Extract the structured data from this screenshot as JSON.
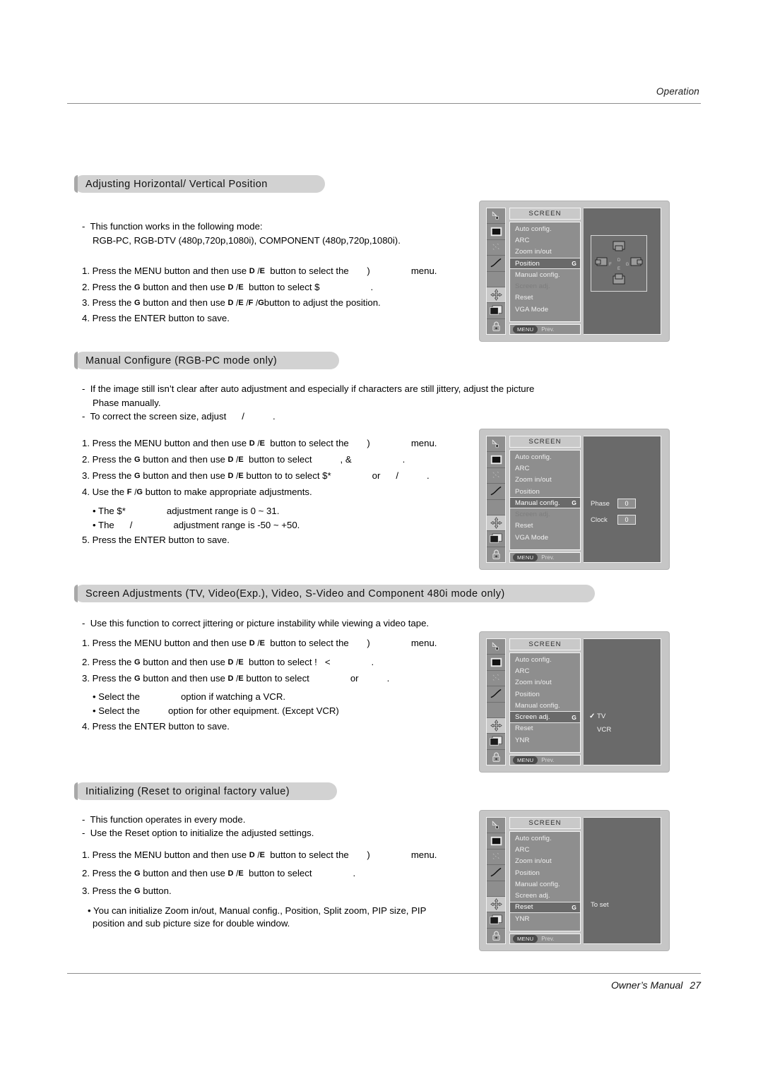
{
  "header": {
    "label": "Operation"
  },
  "footer": {
    "label": "Owner’s Manual",
    "page": "27"
  },
  "sections": [
    {
      "heading": "Adjusting Horizontal/ Vertical Position",
      "lines": {
        "d1a": "-  This function works in the following mode:",
        "d1b": "RGB-PC, RGB-DTV (480p,720p,1080i), COMPONENT (480p,720p,1080i).",
        "s1a": "1. Press the MENU button and then use",
        "s1b": "button to select the",
        "s1c": ")",
        "s1d": "menu.",
        "s2a": "2. Press the",
        "s2b": "button and then use",
        "s2c": "button to select $",
        "s2d": ".",
        "s3a": "3. Press the",
        "s3b": "button and then use",
        "s3c": "button to adjust the position.",
        "s4": "4. Press the ENTER button to save."
      }
    },
    {
      "heading": "Manual Configure (RGB-PC mode only)",
      "lines": {
        "d1a": "-  If the image still isn’t clear after auto adjustment and especially if characters are still jittery, adjust the picture",
        "d1b": "Phase manually.",
        "d2a": "-  To correct the screen size, adjust",
        "d2b": "/",
        "d2c": ".",
        "s1a": "1. Press the MENU button and then use",
        "s1b": "button to select the",
        "s1c": ")",
        "s1d": "menu.",
        "s2a": "2. Press the",
        "s2b": "button and then use",
        "s2c": "button to select",
        "s2d": ", &",
        "s2e": ".",
        "s3a": "3. Press the",
        "s3b": "button and then use",
        "s3c": "button to to select $*",
        "s3d": "or",
        "s3e": "/",
        "s3f": ".",
        "s4a": "4. Use the",
        "s4b": "button to make appropriate adjustments.",
        "b1a": "• The $*",
        "b1b": "adjustment range is 0 ~ 31.",
        "b2a": "• The",
        "b2b": "/",
        "b2c": "adjustment range is -50 ~ +50.",
        "s5": "5. Press the ENTER button to save."
      }
    },
    {
      "heading": "Screen Adjustments (TV, Video(Exp.), Video, S-Video and Component 480i mode only)",
      "lines": {
        "d1": "-  Use this function to correct jittering or picture instability while viewing a video tape.",
        "s1a": "1. Press the MENU button and then use",
        "s1b": "button to select the",
        "s1c": ")",
        "s1d": "menu.",
        "s2a": "2. Press the",
        "s2b": "button and then use",
        "s2c": "button to select",
        "s2d": "!   <",
        "s2e": ".",
        "s3a": "3. Press the",
        "s3b": "button and then use",
        "s3c": "button to select",
        "s3d": "or",
        "s3e": ".",
        "b1a": "• Select the",
        "b1b": "option if watching a VCR.",
        "b2a": "• Select the",
        "b2b": "option for other equipment. (Except VCR)",
        "s4": "4. Press the ENTER button to save."
      }
    },
    {
      "heading": "Initializing (Reset to original factory value)",
      "lines": {
        "d1": "-  This function operates in every mode.",
        "d2": "-  Use the Reset option to initialize the adjusted settings.",
        "s1a": "1. Press the MENU button and then use",
        "s1b": "button to select the",
        "s1c": ")",
        "s1d": "menu.",
        "s2a": "2. Press the",
        "s2b": "button and then use",
        "s2c": "button to select",
        "s2d": ".",
        "s3a": "3. Press the",
        "s3b": "button.",
        "b1a": "• You can initialize Zoom in/out, Manual config., Position, Split zoom, PIP size, PIP",
        "b1b": "position and sub picture size for double window."
      }
    }
  ],
  "keys": {
    "down": "D",
    "up": "E",
    "left": "F",
    "right": "G",
    "slash": "/"
  },
  "osd": {
    "title": "SCREEN",
    "foot_button": "MENU",
    "foot_label": "Prev.",
    "figures": [
      {
        "items": [
          {
            "label": "Auto config.",
            "state": "normal",
            "arrow": ""
          },
          {
            "label": "ARC",
            "state": "normal",
            "arrow": ""
          },
          {
            "label": "Zoom in/out",
            "state": "normal",
            "arrow": ""
          },
          {
            "label": "Position",
            "state": "selected",
            "arrow": "G"
          },
          {
            "label": "Manual config.",
            "state": "normal",
            "arrow": ""
          },
          {
            "label": "Screen adj.",
            "state": "disabled",
            "arrow": ""
          },
          {
            "label": "Reset",
            "state": "normal",
            "arrow": ""
          },
          {
            "label": "VGA Mode",
            "state": "normal",
            "arrow": ""
          }
        ],
        "pane": "position-diagram"
      },
      {
        "items": [
          {
            "label": "Auto config.",
            "state": "normal",
            "arrow": ""
          },
          {
            "label": "ARC",
            "state": "normal",
            "arrow": ""
          },
          {
            "label": "Zoom in/out",
            "state": "normal",
            "arrow": ""
          },
          {
            "label": "Position",
            "state": "normal",
            "arrow": ""
          },
          {
            "label": "Manual config.",
            "state": "selected",
            "arrow": "G"
          },
          {
            "label": "Screen adj.",
            "state": "disabled",
            "arrow": ""
          },
          {
            "label": "Reset",
            "state": "normal",
            "arrow": ""
          },
          {
            "label": "VGA Mode",
            "state": "normal",
            "arrow": ""
          }
        ],
        "pane": "fields",
        "fields": [
          {
            "label": "Phase",
            "value": "0"
          },
          {
            "label": "Clock",
            "value": "0"
          }
        ]
      },
      {
        "items": [
          {
            "label": "Auto config.",
            "state": "normal",
            "arrow": ""
          },
          {
            "label": "ARC",
            "state": "normal",
            "arrow": ""
          },
          {
            "label": "Zoom in/out",
            "state": "normal",
            "arrow": ""
          },
          {
            "label": "Position",
            "state": "normal",
            "arrow": ""
          },
          {
            "label": "Manual config.",
            "state": "normal",
            "arrow": ""
          },
          {
            "label": "Screen adj.",
            "state": "selected",
            "arrow": "G"
          },
          {
            "label": "Reset",
            "state": "normal",
            "arrow": ""
          },
          {
            "label": "YNR",
            "state": "normal",
            "arrow": ""
          }
        ],
        "pane": "options",
        "options": [
          {
            "label": "TV",
            "checked": "✓"
          },
          {
            "label": "VCR",
            "checked": ""
          }
        ]
      },
      {
        "items": [
          {
            "label": "Auto config.",
            "state": "normal",
            "arrow": ""
          },
          {
            "label": "ARC",
            "state": "normal",
            "arrow": ""
          },
          {
            "label": "Zoom in/out",
            "state": "normal",
            "arrow": ""
          },
          {
            "label": "Position",
            "state": "normal",
            "arrow": ""
          },
          {
            "label": "Manual config.",
            "state": "normal",
            "arrow": ""
          },
          {
            "label": "Screen adj.",
            "state": "normal",
            "arrow": ""
          },
          {
            "label": "Reset",
            "state": "selected",
            "arrow": "G"
          },
          {
            "label": "YNR",
            "state": "normal",
            "arrow": ""
          }
        ],
        "pane": "note",
        "note": "To set"
      }
    ],
    "rail_icons": [
      "picture-icon",
      "screen-icon",
      "sparkle-icon",
      "curve-icon",
      "blank-icon",
      "arrows-icon",
      "pip-icon",
      "lock-icon"
    ]
  }
}
